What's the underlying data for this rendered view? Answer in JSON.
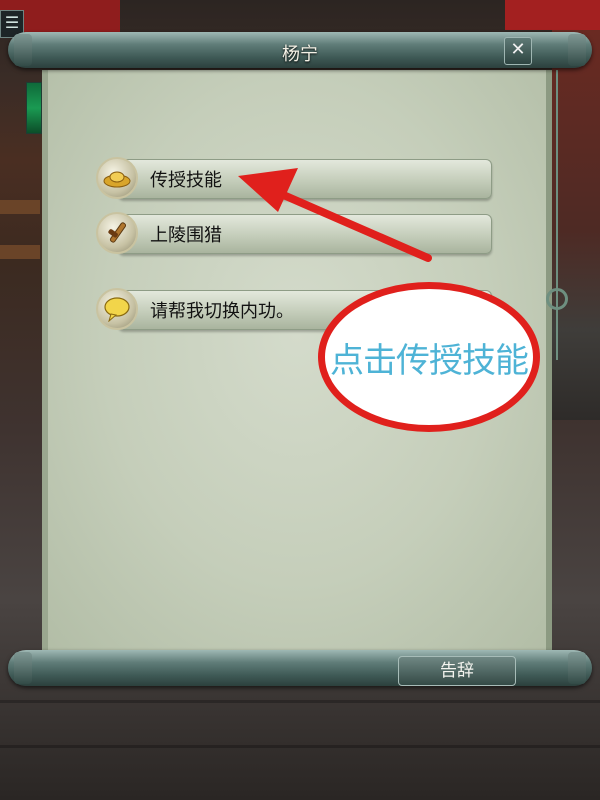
{
  "window": {
    "title": "杨宁",
    "close_symbol": "✕"
  },
  "menu": {
    "icon": "menu-icon",
    "symbol": "☰"
  },
  "options": [
    {
      "label": "传授技能",
      "icon": "gold-ingot-icon"
    },
    {
      "label": "上陵围猎",
      "icon": "scroll-brush-icon"
    },
    {
      "label": "请帮我切换内功。",
      "icon": "speech-bubble-icon"
    }
  ],
  "annotation": {
    "hint_text": "点击传授技能",
    "ellipse_color": "#e0201c",
    "text_color": "#4eb3d6"
  },
  "footer": {
    "farewell_label": "告辞"
  }
}
